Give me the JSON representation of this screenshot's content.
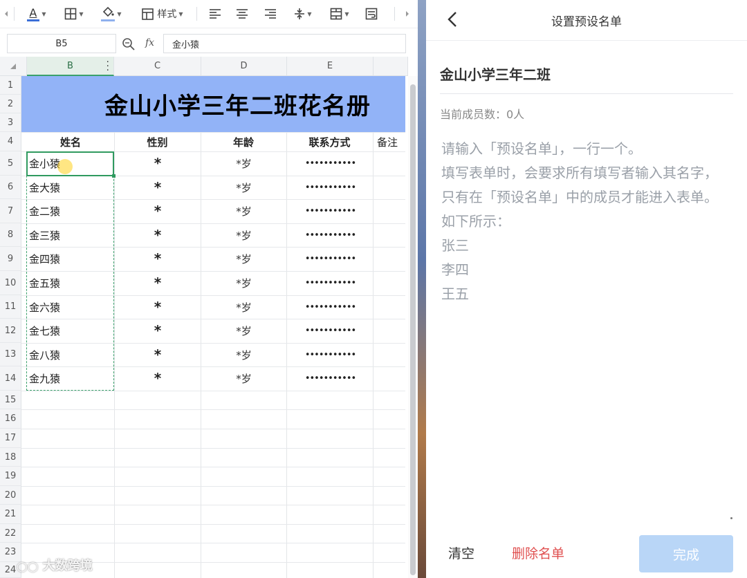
{
  "sheet": {
    "toolbar": {
      "style_label": "样式",
      "font_color": "#3b6fd8",
      "fill_color": "#8fb0ee"
    },
    "name_box": "B5",
    "fx_label": "fx",
    "formula_value": "金小猿",
    "columns": [
      "B",
      "C",
      "D",
      "E"
    ],
    "rows": [
      "1",
      "2",
      "3",
      "4",
      "5",
      "6",
      "7",
      "8",
      "9",
      "10",
      "11",
      "12",
      "13",
      "14",
      "15",
      "16",
      "17",
      "18",
      "19",
      "20",
      "21",
      "22",
      "23",
      "24"
    ],
    "title": "金山小学三年二班花名册",
    "headers": {
      "name": "姓名",
      "gender": "性别",
      "age": "年龄",
      "contact": "联系方式",
      "remark": "备注"
    },
    "records": [
      {
        "name": "金小猿",
        "gender": "*",
        "age": "*岁",
        "contact": "•••••••••••"
      },
      {
        "name": "金大猿",
        "gender": "*",
        "age": "*岁",
        "contact": "•••••••••••"
      },
      {
        "name": "金二猿",
        "gender": "*",
        "age": "*岁",
        "contact": "•••••••••••"
      },
      {
        "name": "金三猿",
        "gender": "*",
        "age": "*岁",
        "contact": "•••••••••••"
      },
      {
        "name": "金四猿",
        "gender": "*",
        "age": "*岁",
        "contact": "•••••••••••"
      },
      {
        "name": "金五猿",
        "gender": "*",
        "age": "*岁",
        "contact": "•••••••••••"
      },
      {
        "name": "金六猿",
        "gender": "*",
        "age": "*岁",
        "contact": "•••••••••••"
      },
      {
        "name": "金七猿",
        "gender": "*",
        "age": "*岁",
        "contact": "•••••••••••"
      },
      {
        "name": "金八猿",
        "gender": "*",
        "age": "*岁",
        "contact": "•••••••••••"
      },
      {
        "name": "金九猿",
        "gender": "*",
        "age": "*岁",
        "contact": "•••••••••••"
      }
    ],
    "title_band_color": "#92b3f7",
    "selection_color": "#3aa06b",
    "watermark": "大数跨境"
  },
  "panel": {
    "title": "设置预设名单",
    "group_name": "金山小学三年二班",
    "member_count": "当前成员数：0人",
    "placeholder_lines": [
      "请输入「预设名单」，一行一个。",
      "填写表单时，会要求所有填写者输入其名字，",
      "只有在「预设名单」中的成员才能进入表单。",
      "如下所示：",
      "张三",
      "李四",
      "王五"
    ],
    "clear_label": "清空",
    "delete_label": "删除名单",
    "done_label": "完成",
    "delete_color": "#e05050",
    "done_color": "#b9d6f7"
  }
}
